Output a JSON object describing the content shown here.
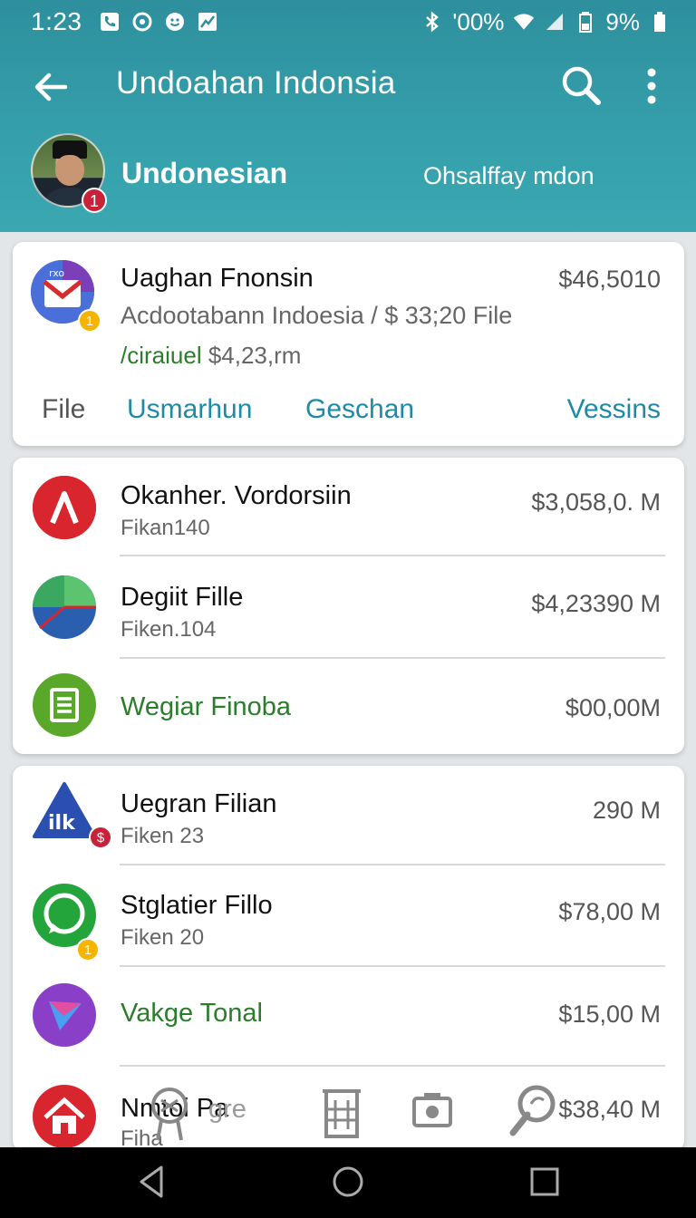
{
  "status": {
    "time": "1:23",
    "battery_pct": "9%",
    "signal_text": "'00%"
  },
  "toolbar": {
    "title": "Undoahan Indonsia"
  },
  "profile": {
    "name": "Undonesian",
    "subtitle": "Ohsalffay mdon",
    "badge": "1"
  },
  "card1": {
    "icon_label": "rxo",
    "badge": "1",
    "title": "Uaghan Fnonsin",
    "amount": "$46,5010",
    "subtitle": "Acdootabann Indoesia / $ 33;20 File",
    "sub2_green": "/ciraiuel",
    "sub2_grey": "$4,23,rm",
    "actions": [
      "File",
      "Usmarhun",
      "Geschan",
      "Vessins"
    ]
  },
  "list1": [
    {
      "title": "Okanher. Vordorsiin",
      "subtitle": "Fikan140",
      "amount": "$3,058,0. M",
      "color": "#d9262e",
      "icon": "triangle-a-icon"
    },
    {
      "title": "Degiit Fille",
      "subtitle": "Fiken.104",
      "amount": "$4,23390 M",
      "color": "#2a6fb0",
      "icon": "pie-chart-icon"
    },
    {
      "title": "Wegiar Finoba",
      "subtitle": "",
      "amount": "$00,00M",
      "color": "#5aa829",
      "icon": "document-icon"
    }
  ],
  "list2": [
    {
      "title": "Uegran Filian",
      "subtitle": "Fiken 23",
      "amount": "290 M",
      "badge": "$",
      "icon": "ilk-logo-icon"
    },
    {
      "title": "Stglatier Fillo",
      "subtitle": "Fiken 20",
      "amount": "$78,00 M",
      "badge": "1",
      "icon": "chat-bubble-icon"
    },
    {
      "title": "Vakge Tonal",
      "subtitle": "",
      "amount": "$15,00 M",
      "icon": "paper-plane-icon"
    },
    {
      "title": "Nmtoi Pa",
      "subtitle": "Fiha",
      "amount": "$38,40 M",
      "icon": "home-icon"
    }
  ],
  "overlay": {
    "label": "gre"
  },
  "colors": {
    "header": "#35a0ab",
    "accent_link": "#1f8aa6",
    "green_text": "#2a7d2a"
  }
}
